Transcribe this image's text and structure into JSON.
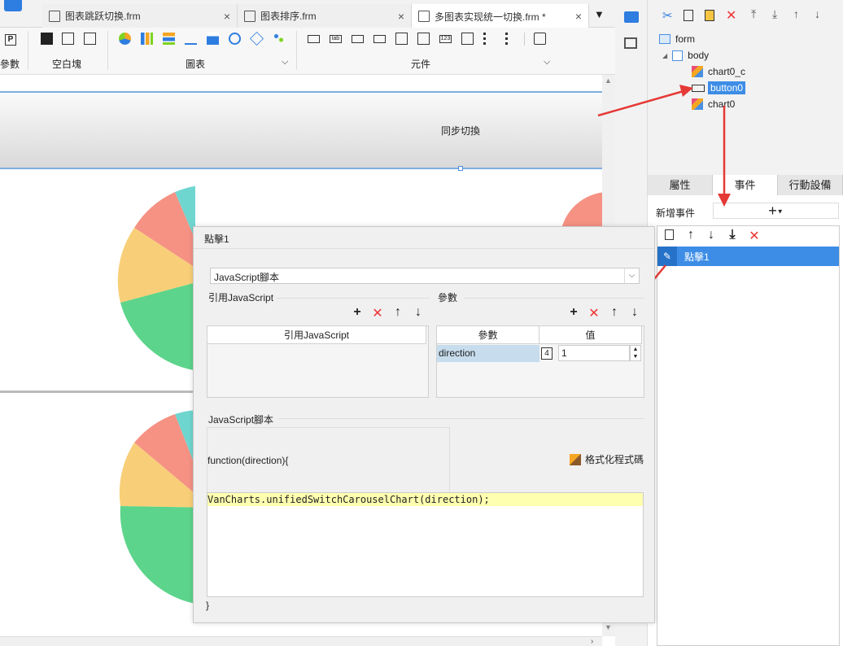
{
  "tabs": [
    {
      "label": "图表跳跃切换.frm",
      "close": "×"
    },
    {
      "label": "图表排序.frm",
      "close": "×"
    },
    {
      "label": "多图表实现统一切换.frm *",
      "close": "×"
    }
  ],
  "ribbon": {
    "groups": [
      {
        "label": "參數"
      },
      {
        "label": "空白塊"
      },
      {
        "label": "圖表"
      },
      {
        "label": "元件"
      }
    ]
  },
  "canvas": {
    "button_text": "同步切換"
  },
  "tree": {
    "form": "form",
    "body": "body",
    "items": [
      "chart0_c",
      "button0",
      "chart0"
    ]
  },
  "panel_tabs": [
    "屬性",
    "事件",
    "行動設備"
  ],
  "new_event": {
    "label": "新增事件",
    "add": "+"
  },
  "event_list": [
    {
      "label": "點擊1"
    }
  ],
  "dialog": {
    "title": "點擊1",
    "type_select": "JavaScript腳本",
    "ref_js": {
      "title": "引用JavaScript",
      "column": "引用JavaScript"
    },
    "params": {
      "title": "參數",
      "columns": [
        "參數",
        "值"
      ],
      "rows": [
        {
          "name": "direction",
          "type_badge": "4",
          "value": "1"
        }
      ]
    },
    "script": {
      "title": "JavaScript腳本",
      "header": "function(direction){",
      "format_button": "格式化程式碼",
      "code": "VanCharts.unifiedSwitchCarouselChart(direction);",
      "footer": "}"
    }
  }
}
